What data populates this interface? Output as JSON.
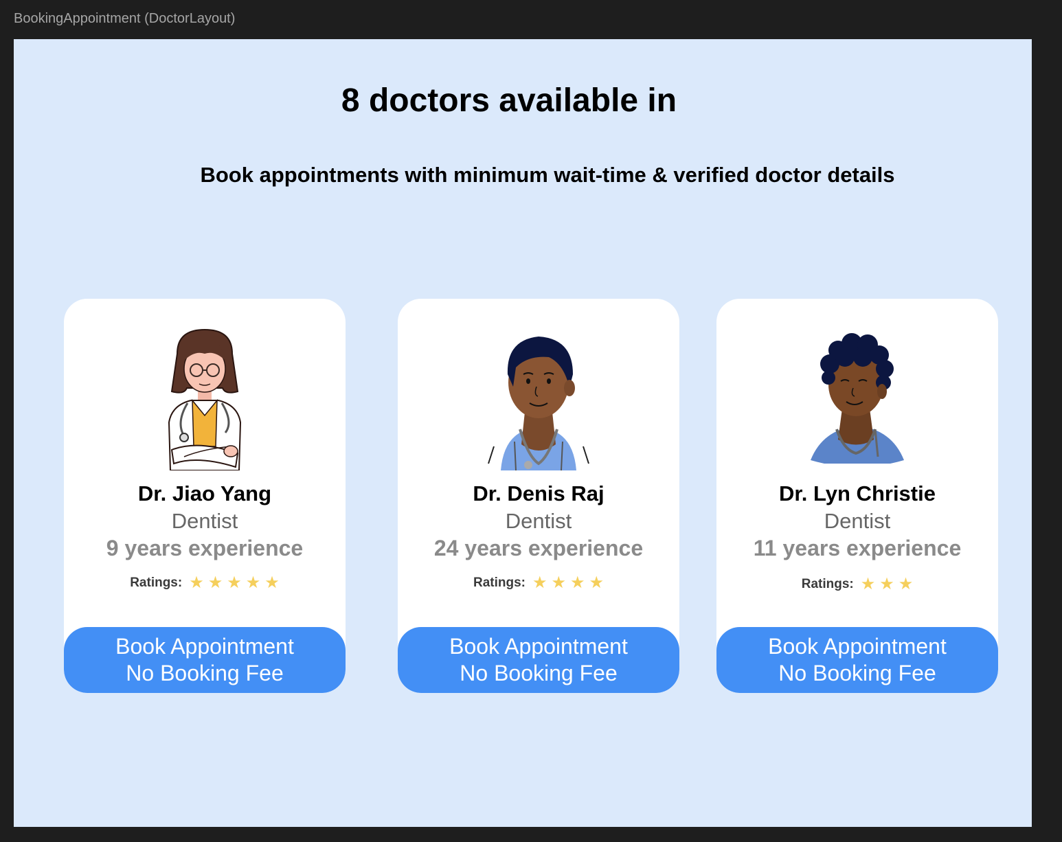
{
  "frame": {
    "label": "BookingAppointment (DoctorLayout)"
  },
  "page": {
    "headline": "8 doctors available in",
    "subheadline": "Book appointments with minimum wait-time & verified doctor details"
  },
  "colors": {
    "page_background": "#dbe9fb",
    "card_background": "#ffffff",
    "button_background": "#438ff5",
    "star": "#f5cf5c"
  },
  "doctors": [
    {
      "name": "Dr. Jiao Yang",
      "specialty": "Dentist",
      "experience": "9 years experience",
      "ratings_label": "Ratings:",
      "rating": 5,
      "avatar_icon": "female-doctor-avatar-icon",
      "button_line1": "Book Appointment",
      "button_line2": "No Booking Fee"
    },
    {
      "name": "Dr. Denis Raj",
      "specialty": "Dentist",
      "experience": "24 years experience",
      "ratings_label": "Ratings:",
      "rating": 4,
      "avatar_icon": "male-doctor-avatar-icon",
      "button_line1": "Book Appointment",
      "button_line2": "No Booking Fee"
    },
    {
      "name": "Dr. Lyn Christie",
      "specialty": "Dentist",
      "experience": "11 years experience",
      "ratings_label": "Ratings:",
      "rating": 3,
      "avatar_icon": "curly-hair-doctor-avatar-icon",
      "button_line1": "Book Appointment",
      "button_line2": "No Booking Fee"
    }
  ]
}
